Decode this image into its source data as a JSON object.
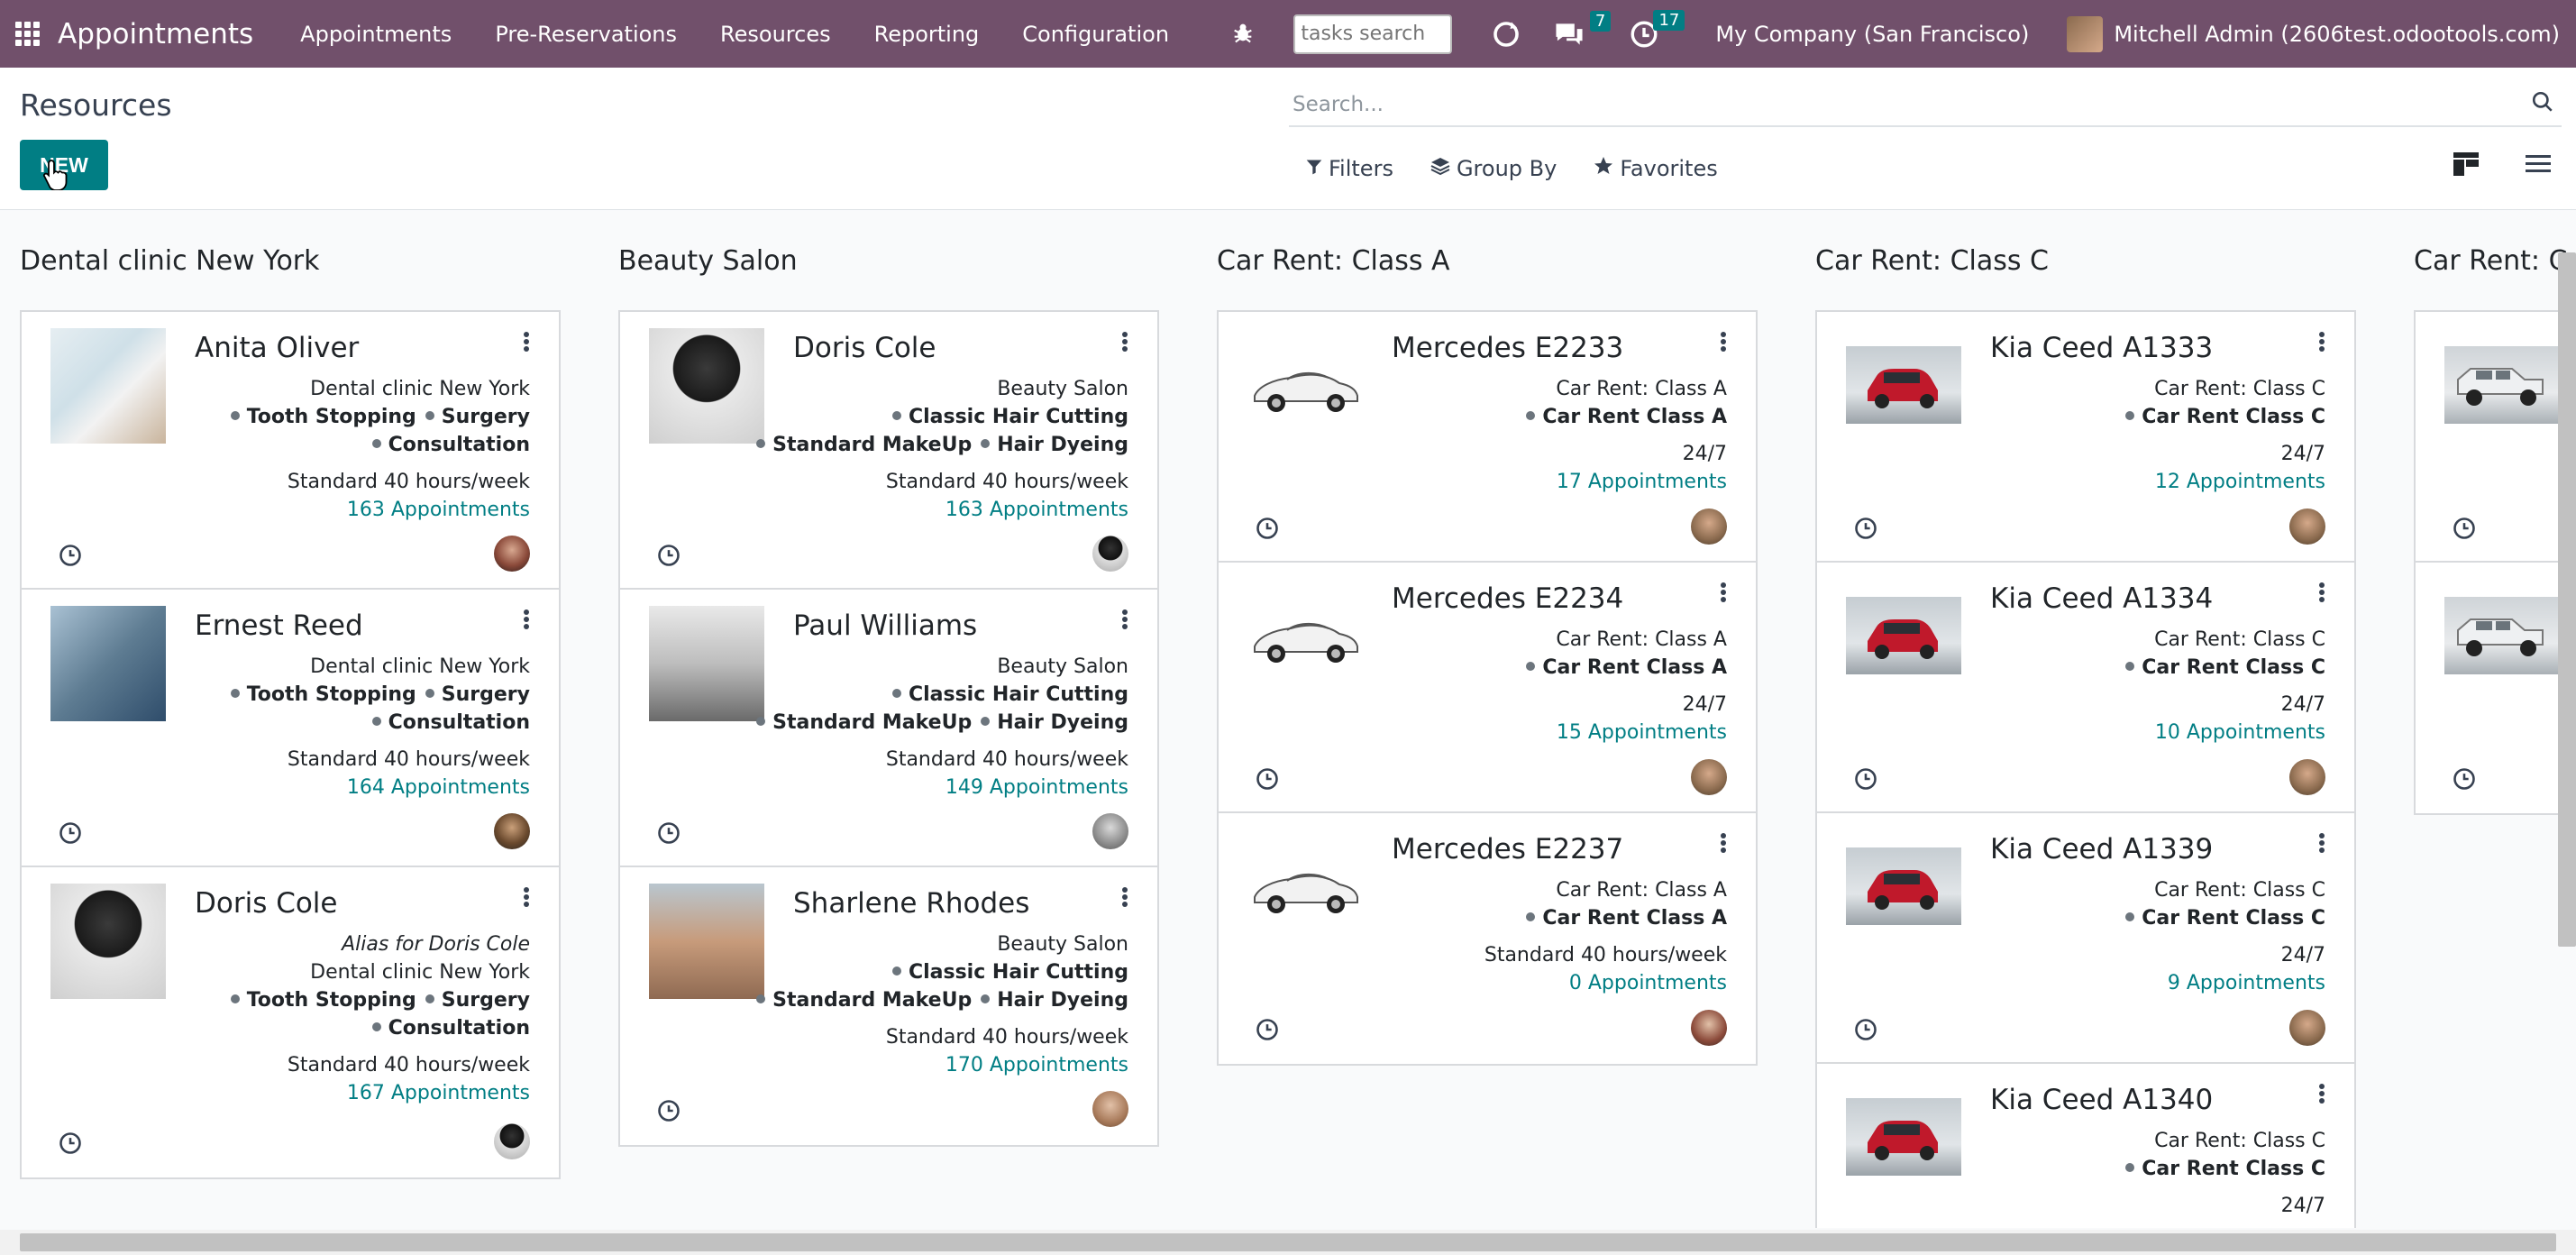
{
  "navbar": {
    "brand": "Appointments",
    "menu": [
      "Appointments",
      "Pre-Reservations",
      "Resources",
      "Reporting",
      "Configuration"
    ],
    "task_search_placeholder": "tasks search",
    "messages_count": "7",
    "activities_count": "17",
    "company": "My Company (San Francisco)",
    "user": "Mitchell Admin (2606test.odootools.com)",
    "accent_color": "#71506b"
  },
  "control": {
    "title": "Resources",
    "new_label": "NEW",
    "search_placeholder": "Search...",
    "filters_label": "Filters",
    "groupby_label": "Group By",
    "favorites_label": "Favorites"
  },
  "columns": [
    {
      "title": "Dental clinic New York",
      "cards": [
        {
          "name": "Anita Oliver",
          "lines": [
            "Dental clinic New York"
          ],
          "tags_row1": [
            "Tooth Stopping",
            "Surgery"
          ],
          "tags_row2": [
            "Consultation"
          ],
          "calendar": "Standard 40 hours/week",
          "appointments": "163 Appointments",
          "photo": "lab"
        },
        {
          "name": "Ernest Reed",
          "lines": [
            "Dental clinic New York"
          ],
          "tags_row1": [
            "Tooth Stopping",
            "Surgery"
          ],
          "tags_row2": [
            "Consultation"
          ],
          "calendar": "Standard 40 hours/week",
          "appointments": "164 Appointments",
          "photo": "surg"
        },
        {
          "name": "Doris Cole",
          "alias": "Alias for Doris Cole",
          "lines": [
            "Dental clinic New York"
          ],
          "tags_row1": [
            "Tooth Stopping",
            "Surgery"
          ],
          "tags_row2": [
            "Consultation"
          ],
          "calendar": "Standard 40 hours/week",
          "appointments": "167 Appointments",
          "photo": "bw"
        }
      ]
    },
    {
      "title": "Beauty Salon",
      "cards": [
        {
          "name": "Doris Cole",
          "lines": [
            "Beauty Salon"
          ],
          "tags_row1": [
            "Classic Hair Cutting"
          ],
          "tags_row2": [
            "Standard MakeUp",
            "Hair Dyeing"
          ],
          "calendar": "Standard 40 hours/week",
          "appointments": "163 Appointments",
          "photo": "bw"
        },
        {
          "name": "Paul Williams",
          "lines": [
            "Beauty Salon"
          ],
          "tags_row1": [
            "Classic Hair Cutting"
          ],
          "tags_row2": [
            "Standard MakeUp",
            "Hair Dyeing"
          ],
          "calendar": "Standard 40 hours/week",
          "appointments": "149 Appointments",
          "photo": "man"
        },
        {
          "name": "Sharlene Rhodes",
          "lines": [
            "Beauty Salon"
          ],
          "tags_row1": [
            "Classic Hair Cutting"
          ],
          "tags_row2": [
            "Standard MakeUp",
            "Hair Dyeing"
          ],
          "calendar": "Standard 40 hours/week",
          "appointments": "170 Appointments",
          "photo": "woman"
        }
      ]
    },
    {
      "title": "Car Rent: Class A",
      "cards": [
        {
          "name": "Mercedes E2233",
          "lines": [
            "Car Rent: Class A"
          ],
          "tags_row1": [
            "Car Rent Class A"
          ],
          "tags_row2": [],
          "calendar": "24/7",
          "appointments": "17 Appointments",
          "photo": "mercedes"
        },
        {
          "name": "Mercedes E2234",
          "lines": [
            "Car Rent: Class A"
          ],
          "tags_row1": [
            "Car Rent Class A"
          ],
          "tags_row2": [],
          "calendar": "24/7",
          "appointments": "15 Appointments",
          "photo": "mercedes"
        },
        {
          "name": "Mercedes E2237",
          "lines": [
            "Car Rent: Class A"
          ],
          "tags_row1": [
            "Car Rent Class A"
          ],
          "tags_row2": [],
          "calendar": "Standard 40 hours/week",
          "appointments": "0 Appointments",
          "photo": "mercedes"
        }
      ]
    },
    {
      "title": "Car Rent: Class C",
      "cards": [
        {
          "name": "Kia Ceed A1333",
          "lines": [
            "Car Rent: Class C"
          ],
          "tags_row1": [
            "Car Rent Class C"
          ],
          "tags_row2": [],
          "calendar": "24/7",
          "appointments": "12 Appointments",
          "photo": "kia"
        },
        {
          "name": "Kia Ceed A1334",
          "lines": [
            "Car Rent: Class C"
          ],
          "tags_row1": [
            "Car Rent Class C"
          ],
          "tags_row2": [],
          "calendar": "24/7",
          "appointments": "10 Appointments",
          "photo": "kia"
        },
        {
          "name": "Kia Ceed A1339",
          "lines": [
            "Car Rent: Class C"
          ],
          "tags_row1": [
            "Car Rent Class C"
          ],
          "tags_row2": [],
          "calendar": "24/7",
          "appointments": "9 Appointments",
          "photo": "kia"
        },
        {
          "name": "Kia Ceed A1340",
          "lines": [
            "Car Rent: Class C"
          ],
          "tags_row1": [
            "Car Rent Class C"
          ],
          "tags_row2": [],
          "calendar": "24/7",
          "appointments": "",
          "photo": "kia"
        }
      ]
    },
    {
      "title": "Car Rent: C",
      "cards": [
        {
          "name": "",
          "lines": [],
          "tags_row1": [],
          "tags_row2": [],
          "calendar": "",
          "appointments": "",
          "photo": "jeep"
        },
        {
          "name": "",
          "lines": [],
          "tags_row1": [],
          "tags_row2": [],
          "calendar": "",
          "appointments": "",
          "photo": "jeep"
        }
      ]
    }
  ]
}
